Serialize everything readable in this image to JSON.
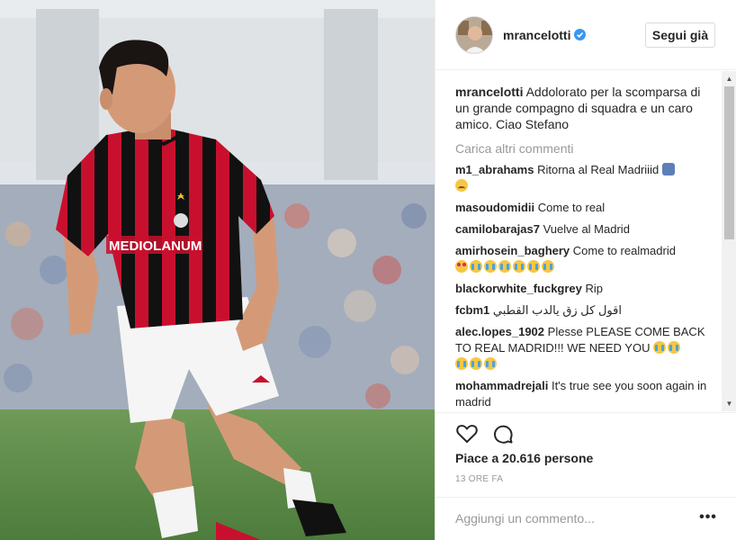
{
  "post": {
    "author": "mrancelotti",
    "follow_label": "Segui già",
    "caption_user": "mrancelotti",
    "caption_text": "Addolorato per la scomparsa di un grande compagno di squadra e un caro amico. Ciao Stefano",
    "load_more_label": "Carica altri commenti",
    "likes_text": "Piace a 20.616 persone",
    "timestamp": "13 ORE FA",
    "add_comment_placeholder": "Aggiungi un commento...",
    "more_label": "•••",
    "photo_shirt_text": "MEDIOLANUM"
  },
  "comments": [
    {
      "user": "m1_abrahams",
      "text": "Ritorna al Real Madriiid",
      "emojis": [
        "person",
        "sad"
      ]
    },
    {
      "user": "masoudomidii",
      "text": "Come to real",
      "emojis": []
    },
    {
      "user": "camilobarajas7",
      "text": "Vuelve al Madrid",
      "emojis": []
    },
    {
      "user": "amirhosein_baghery",
      "text": "Come to realmadrid",
      "emojis": [
        "love",
        "cry",
        "cry",
        "cry",
        "cry",
        "cry",
        "cry"
      ]
    },
    {
      "user": "blackorwhite_fuckgrey",
      "text": "Rip",
      "emojis": []
    },
    {
      "user": "fcbm1",
      "text": "اقول كل زق يالدب القطبي",
      "emojis": []
    },
    {
      "user": "alec.lopes_1902",
      "text": "Plesse PLEASE COME BACK TO REAL MADRID!!! WE NEED YOU",
      "emojis": [
        "cry",
        "cry",
        "cry",
        "cry",
        "cry"
      ]
    },
    {
      "user": "mohammadrejali",
      "text": "It's true see you soon again in madrid",
      "emojis": []
    }
  ],
  "icons": {
    "verified": "verified-badge-icon",
    "like": "heart-icon",
    "comment": "comment-bubble-icon",
    "more": "more-options-icon"
  },
  "colors": {
    "verified": "#3897f0",
    "milan_red": "#c8102e",
    "milan_black": "#111111",
    "muted_text": "#999999"
  }
}
